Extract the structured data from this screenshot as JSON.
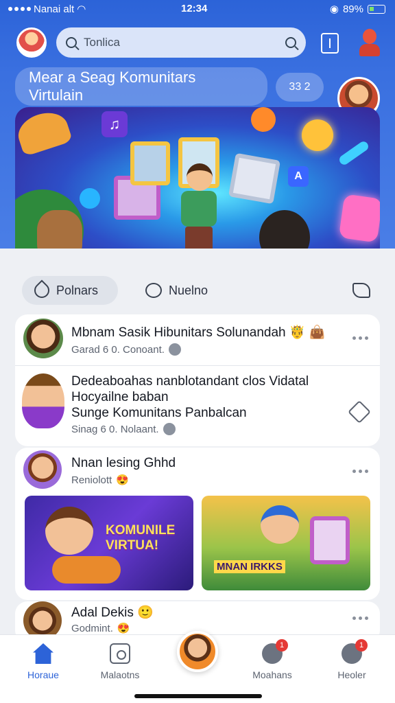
{
  "status_bar": {
    "carrier": "Nanai alt",
    "time": "12:34",
    "battery": "89%"
  },
  "topbar": {
    "search_placeholder": "Tonlica"
  },
  "hero": {
    "title": "Mear a Seag Komunitars Virtulain",
    "count": "33 2",
    "banner_alt": ""
  },
  "tabs": [
    {
      "label": "Polnars",
      "active": true
    },
    {
      "label": "Nuelno",
      "active": false
    }
  ],
  "posts": [
    {
      "title": "Mbnam Sasik Hibunitars Solunandah",
      "meta": "Garad 6 0. Conoant."
    },
    {
      "title_lines": [
        "Dedeaboahas nanblotandant clos Vidatal",
        "Hocyailne baban",
        "Sunge Komunitans Panbalcan"
      ],
      "meta": "Sinag 6 0. Nolaant."
    },
    {
      "title": "Nnan lesing Ghhd",
      "meta": "Reniolott",
      "images": [
        {
          "caption": "KOMUNILE VIRTUA!"
        },
        {
          "caption": "MNAN IRKKS"
        }
      ]
    },
    {
      "title": "Adal Dekis",
      "meta": "Godmint."
    }
  ],
  "bottom_nav": [
    {
      "label": "Horaue",
      "icon": "home-icon",
      "active": true
    },
    {
      "label": "Malaotns",
      "icon": "camera-icon",
      "active": false
    },
    {
      "label": "Moahans",
      "icon": "phone-icon",
      "badge": "1",
      "active": false
    },
    {
      "label": "Heoler",
      "icon": "user-icon",
      "badge": "1",
      "active": false
    }
  ],
  "colors": {
    "brand": "#2d63d8",
    "badge": "#e53935"
  }
}
